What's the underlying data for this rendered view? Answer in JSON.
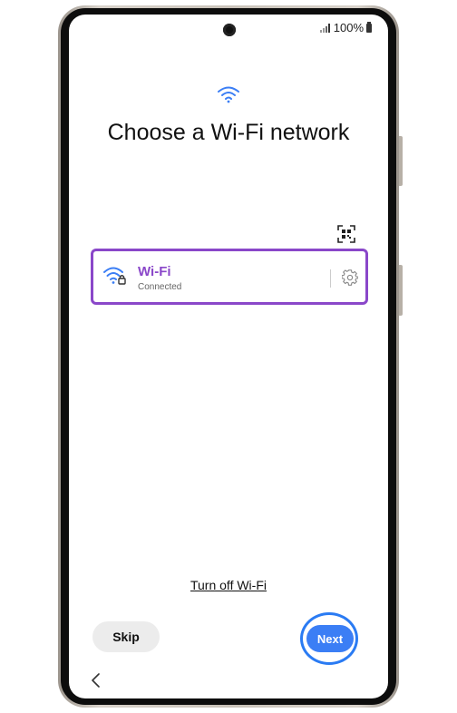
{
  "status_bar": {
    "battery": "100%",
    "icons": [
      "signal-icon",
      "battery-icon"
    ]
  },
  "header": {
    "icon": "wifi-icon",
    "title": "Choose a Wi-Fi network"
  },
  "toolbar": {
    "qr_icon": "qr-code-scan-icon"
  },
  "network": {
    "icon": "wifi-lock-icon",
    "name": "Wi-Fi",
    "status": "Connected",
    "settings_icon": "gear-icon"
  },
  "footer": {
    "turn_off_label": "Turn off Wi-Fi",
    "skip_label": "Skip",
    "next_label": "Next"
  },
  "nav": {
    "back_icon": "chevron-left-icon"
  },
  "colors": {
    "accent_purple": "#8a47c9",
    "accent_blue": "#3b7ef5",
    "highlight_blue": "#2a7bf3"
  }
}
